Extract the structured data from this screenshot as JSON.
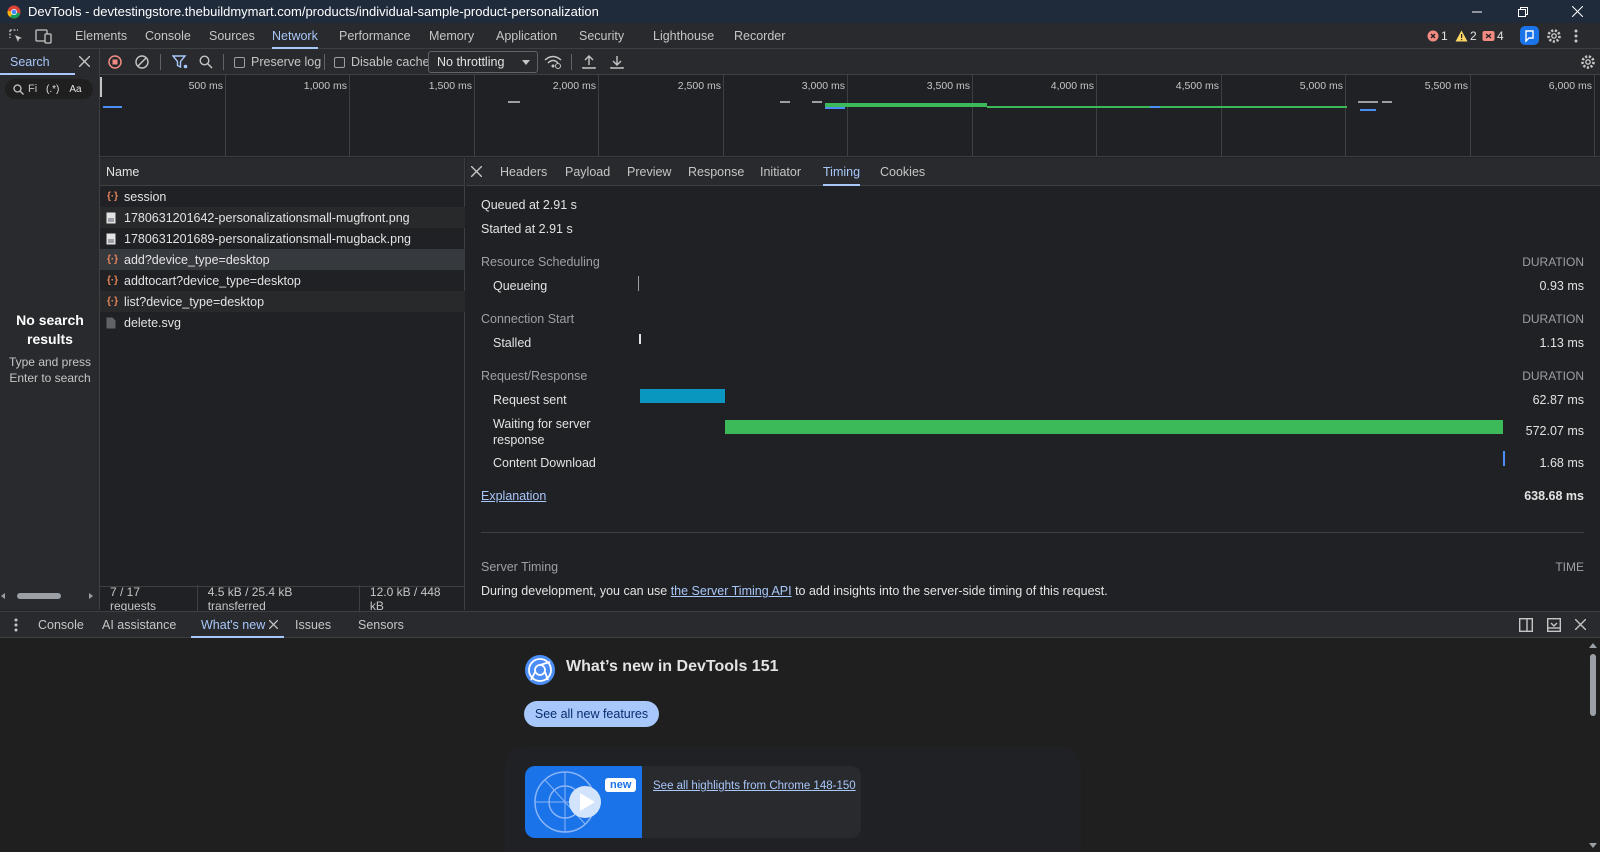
{
  "window": {
    "title": "DevTools - devtestingstore.thebuildmymart.com/products/individual-sample-product-personalization"
  },
  "main_tabs": [
    "Elements",
    "Console",
    "Sources",
    "Network",
    "Performance",
    "Memory",
    "Application",
    "Security",
    "Lighthouse",
    "Recorder"
  ],
  "active_main_tab": "Network",
  "status_badges": {
    "errors": "1",
    "warnings": "2",
    "issues": "4"
  },
  "search_panel": {
    "tab_label": "Search",
    "input_placeholder": "Fi",
    "regex_label": "(.*)",
    "case_label": "Aa",
    "no_results_title": "No search results",
    "no_results_hint": "Type and press Enter to search"
  },
  "toolbar": {
    "preserve_log": "Preserve log",
    "disable_cache": "Disable cache",
    "throttling": "No throttling"
  },
  "overview": {
    "ticks": [
      "500 ms",
      "1,000 ms",
      "1,500 ms",
      "2,000 ms",
      "2,500 ms",
      "3,000 ms",
      "3,500 ms",
      "4,000 ms",
      "4,500 ms",
      "5,000 ms",
      "5,500 ms",
      "6,000 ms"
    ]
  },
  "request_list": {
    "column_name": "Name",
    "rows": [
      {
        "name": "session",
        "type": "xhr"
      },
      {
        "name": "1780631201642-personalizationsmall-mugfront.png",
        "type": "img"
      },
      {
        "name": "1780631201689-personalizationsmall-mugback.png",
        "type": "img"
      },
      {
        "name": "add?device_type=desktop",
        "type": "xhr",
        "selected": true
      },
      {
        "name": "addtocart?device_type=desktop",
        "type": "xhr"
      },
      {
        "name": "list?device_type=desktop",
        "type": "xhr"
      },
      {
        "name": "delete.svg",
        "type": "doc"
      }
    ],
    "status": {
      "requests": "7 / 17 requests",
      "transferred": "4.5 kB / 25.4 kB transferred",
      "resources": "12.0 kB / 448 kB"
    }
  },
  "detail_tabs": [
    "Headers",
    "Payload",
    "Preview",
    "Response",
    "Initiator",
    "Timing",
    "Cookies"
  ],
  "active_detail_tab": "Timing",
  "timing": {
    "queued_at": "Queued at 2.91 s",
    "started_at": "Started at 2.91 s",
    "duration_header": "DURATION",
    "sections": {
      "resource_scheduling": "Resource Scheduling",
      "connection_start": "Connection Start",
      "request_response": "Request/Response"
    },
    "rows": {
      "queueing": {
        "label": "Queueing",
        "value": "0.93 ms"
      },
      "stalled": {
        "label": "Stalled",
        "value": "1.13 ms"
      },
      "request_sent": {
        "label": "Request sent",
        "value": "62.87 ms"
      },
      "waiting": {
        "label": "Waiting for server response",
        "value": "572.07 ms"
      },
      "content_download": {
        "label": "Content Download",
        "value": "1.68 ms"
      }
    },
    "explanation": "Explanation",
    "total": "638.68 ms",
    "server_timing": {
      "title": "Server Timing",
      "time_header": "TIME",
      "text_before": "During development, you can use ",
      "link": "the Server Timing API",
      "text_after": " to add insights into the server-side timing of this request."
    }
  },
  "drawer_tabs": [
    "Console",
    "AI assistance",
    "What's new",
    "Issues",
    "Sensors"
  ],
  "active_drawer_tab": "What's new",
  "whats_new": {
    "title": "What’s new in DevTools 151",
    "button": "See all new features",
    "badge": "new",
    "highlight_link": "See all highlights from Chrome 148-150"
  },
  "colors": {
    "accent": "#a8c7fa",
    "request_sent_bar": "#0997c0",
    "waiting_bar": "#3cba5a",
    "download_bar": "#4c8df6",
    "error": "#f28b82",
    "warning": "#fdd663",
    "xhr_icon": "#e8855a"
  }
}
